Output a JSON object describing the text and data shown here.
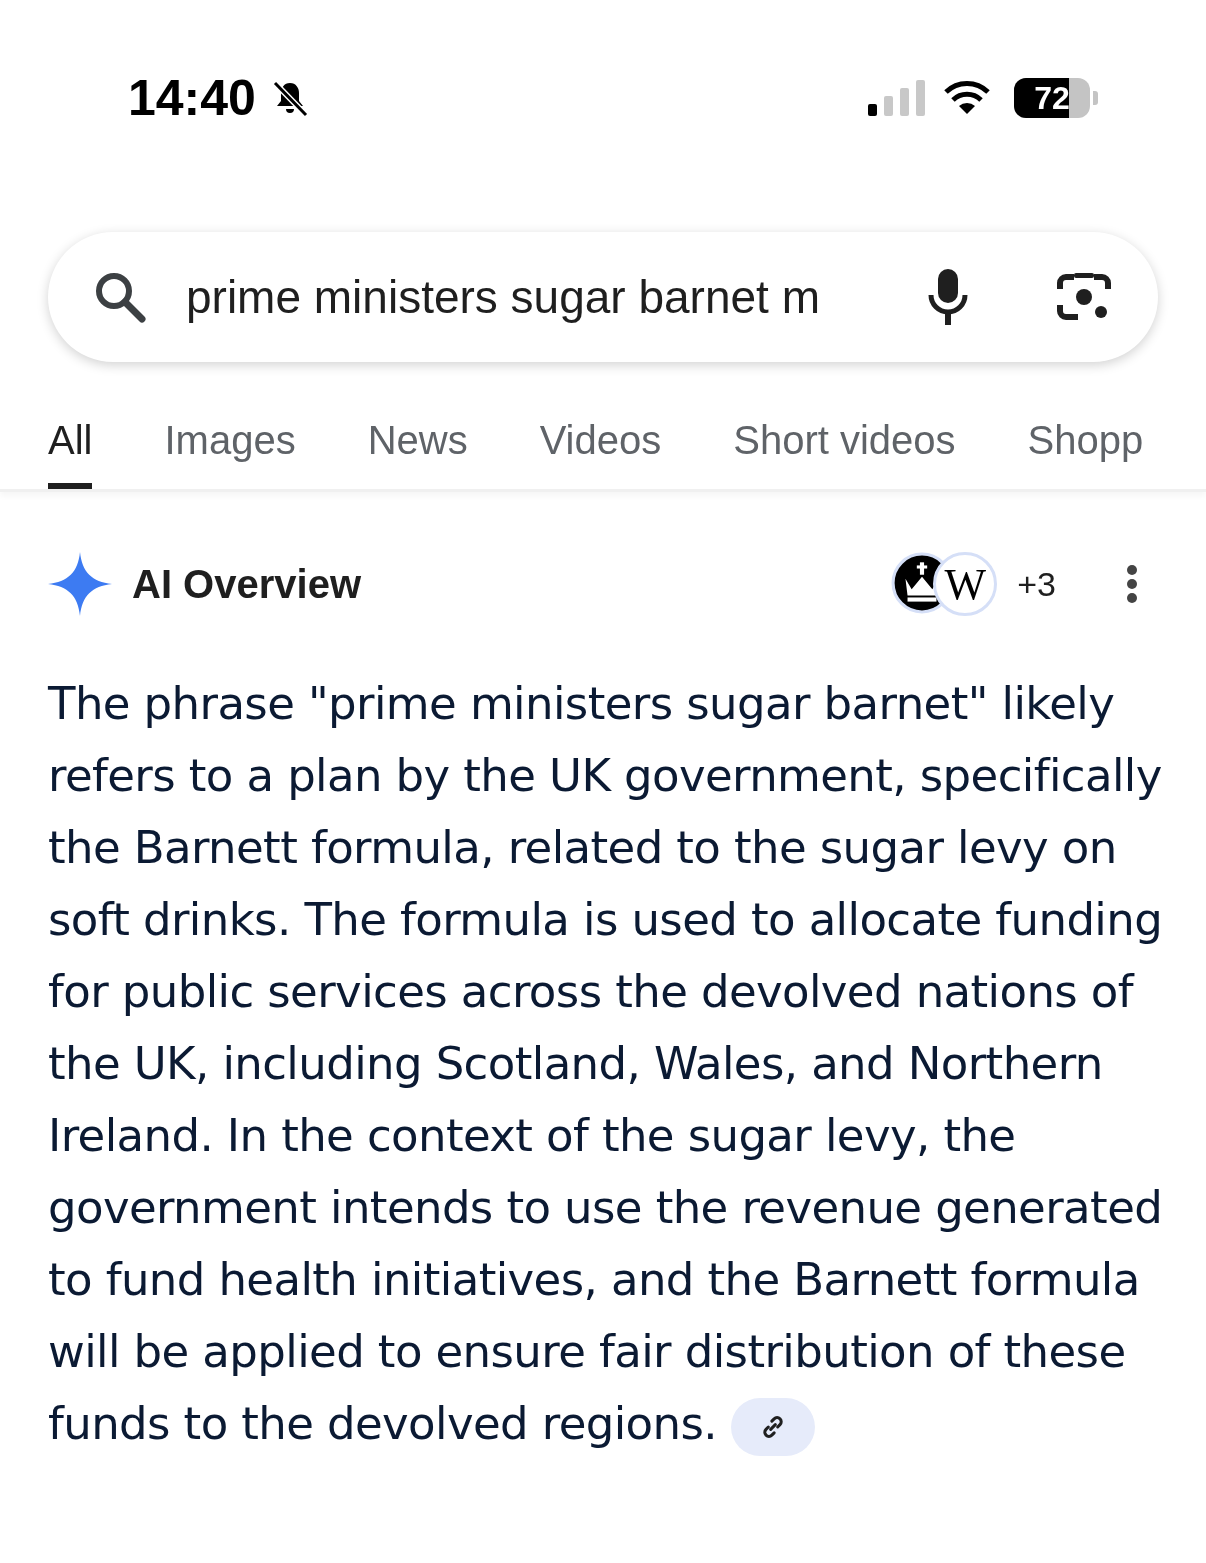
{
  "status_bar": {
    "time": "14:40",
    "silent": true,
    "battery": {
      "level": 0.72,
      "reading": "72"
    }
  },
  "search": {
    "value": "prime ministers sugar barnet m"
  },
  "tabs": [
    {
      "label": "All",
      "selected": true
    },
    {
      "label": "Images",
      "selected": false
    },
    {
      "label": "News",
      "selected": false
    },
    {
      "label": "Videos",
      "selected": false
    },
    {
      "label": "Short videos",
      "selected": false
    },
    {
      "label": "Shopp",
      "selected": false
    }
  ],
  "ai_overview": {
    "title": "AI Overview",
    "sources": [
      {
        "kind": "crown"
      },
      {
        "kind": "letter",
        "letter": "W"
      }
    ],
    "more_sources": "+3",
    "text": "The phrase \"prime ministers sugar barnet\" likely refers to a plan by the UK government, specifically the Barnett formula, related to the sugar levy on soft drinks. The formula is used to allocate funding for public services across the devolved nations of the UK, including Scotland, Wales, and Northern Ireland. In the context of the sugar levy, the government intends to use the revenue generated to fund health initiatives, and the Barnett formula will be applied to ensure fair distribution of these funds to the devolved regions."
  }
}
